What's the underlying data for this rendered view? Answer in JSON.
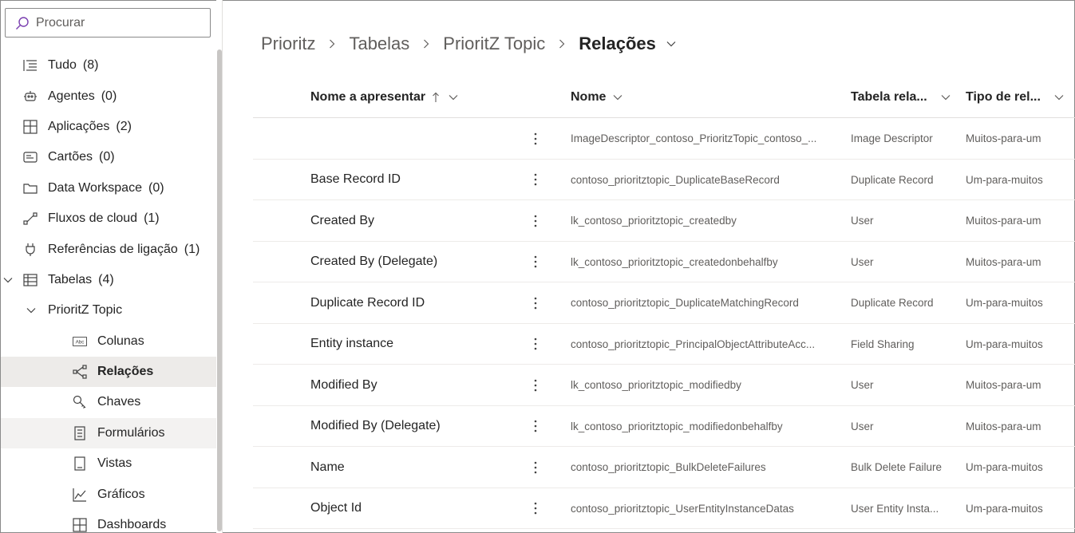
{
  "search": {
    "placeholder": "Procurar"
  },
  "sidebar": {
    "items": [
      {
        "label": "Tudo",
        "count": "(8)"
      },
      {
        "label": "Agentes",
        "count": "(0)"
      },
      {
        "label": "Aplicações",
        "count": "(2)"
      },
      {
        "label": "Cartões",
        "count": "(0)"
      },
      {
        "label": "Data Workspace",
        "count": "(0)"
      },
      {
        "label": "Fluxos de cloud",
        "count": "(1)"
      },
      {
        "label": "Referências de ligação",
        "count": "(1)"
      },
      {
        "label": "Tabelas",
        "count": "(4)"
      },
      {
        "label": "PrioritZ Topic"
      },
      {
        "label": "Colunas"
      },
      {
        "label": "Relações"
      },
      {
        "label": "Chaves"
      },
      {
        "label": "Formulários"
      },
      {
        "label": "Vistas"
      },
      {
        "label": "Gráficos"
      },
      {
        "label": "Dashboards"
      }
    ]
  },
  "breadcrumb": [
    "Prioritz",
    "Tabelas",
    "PrioritZ Topic",
    "Relações"
  ],
  "table": {
    "headers": [
      "Nome a apresentar",
      "Nome",
      "Tabela rela...",
      "Tipo de rel..."
    ],
    "rows": [
      [
        "",
        "ImageDescriptor_contoso_PrioritzTopic_contoso_...",
        "Image Descriptor",
        "Muitos-para-um"
      ],
      [
        "Base Record ID",
        "contoso_prioritztopic_DuplicateBaseRecord",
        "Duplicate Record",
        "Um-para-muitos"
      ],
      [
        "Created By",
        "lk_contoso_prioritztopic_createdby",
        "User",
        "Muitos-para-um"
      ],
      [
        "Created By (Delegate)",
        "lk_contoso_prioritztopic_createdonbehalfby",
        "User",
        "Muitos-para-um"
      ],
      [
        "Duplicate Record ID",
        "contoso_prioritztopic_DuplicateMatchingRecord",
        "Duplicate Record",
        "Um-para-muitos"
      ],
      [
        "Entity instance",
        "contoso_prioritztopic_PrincipalObjectAttributeAcc...",
        "Field Sharing",
        "Um-para-muitos"
      ],
      [
        "Modified By",
        "lk_contoso_prioritztopic_modifiedby",
        "User",
        "Muitos-para-um"
      ],
      [
        "Modified By (Delegate)",
        "lk_contoso_prioritztopic_modifiedonbehalfby",
        "User",
        "Muitos-para-um"
      ],
      [
        "Name",
        "contoso_prioritztopic_BulkDeleteFailures",
        "Bulk Delete Failure",
        "Um-para-muitos"
      ],
      [
        "Object Id",
        "contoso_prioritztopic_UserEntityInstanceDatas",
        "User Entity Insta...",
        "Um-para-muitos"
      ]
    ]
  }
}
